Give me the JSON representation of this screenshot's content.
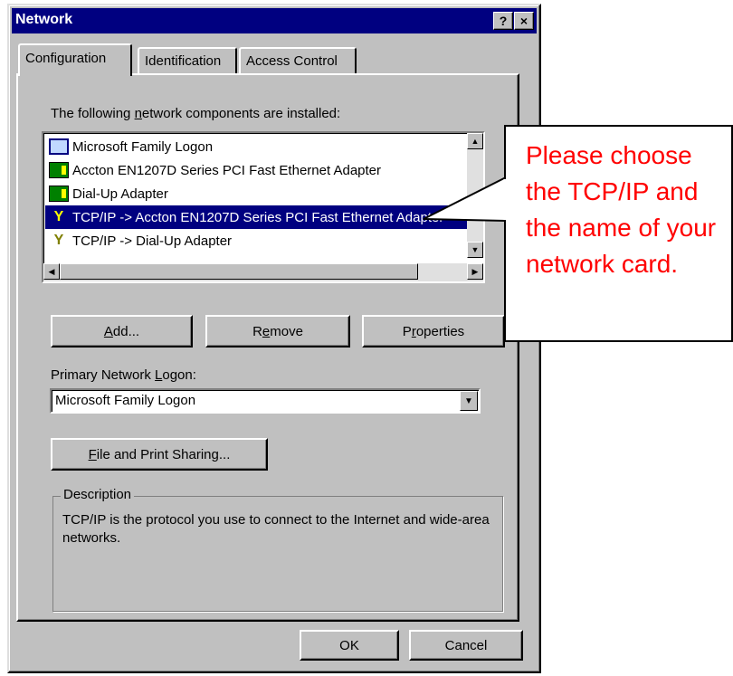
{
  "window": {
    "title": "Network",
    "help_glyph": "?",
    "close_glyph": "×"
  },
  "tabs": [
    {
      "label": "Configuration",
      "active": true
    },
    {
      "label": "Identification",
      "active": false
    },
    {
      "label": "Access Control",
      "active": false
    }
  ],
  "components": {
    "label_pre": "The following ",
    "label_u": "n",
    "label_post": "etwork components are installed:",
    "items": [
      {
        "label": "Microsoft Family Logon",
        "icon": "client-icon",
        "selected": false
      },
      {
        "label": "Accton EN1207D Series PCI Fast Ethernet Adapter",
        "icon": "network-card-icon",
        "selected": false
      },
      {
        "label": "Dial-Up Adapter",
        "icon": "network-card-icon",
        "selected": false
      },
      {
        "label": "TCP/IP -> Accton EN1207D Series PCI Fast Ethernet Adapter",
        "icon": "protocol-icon",
        "selected": true
      },
      {
        "label": "TCP/IP -> Dial-Up Adapter",
        "icon": "protocol-icon",
        "selected": false
      }
    ]
  },
  "buttons": {
    "add": {
      "pre": "",
      "u": "A",
      "post": "dd..."
    },
    "remove": {
      "pre": "R",
      "u": "e",
      "post": "move"
    },
    "properties": {
      "pre": "P",
      "u": "r",
      "post": "operties"
    },
    "file_print": {
      "pre": "",
      "u": "F",
      "post": "ile and Print Sharing..."
    },
    "ok": "OK",
    "cancel": "Cancel"
  },
  "primary_logon": {
    "label_pre": "Primary Network ",
    "label_u": "L",
    "label_post": "ogon:",
    "value": "Microsoft Family Logon"
  },
  "description": {
    "legend": "Description",
    "text": "TCP/IP is the protocol you use to connect to the Internet and wide-area networks."
  },
  "callout": {
    "text": "Please choose the TCP/IP and the name of your network card.",
    "color": "#ff0000"
  },
  "colors": {
    "titlebar": "#000080",
    "dialog": "#c0c0c0",
    "selection": "#000080"
  }
}
